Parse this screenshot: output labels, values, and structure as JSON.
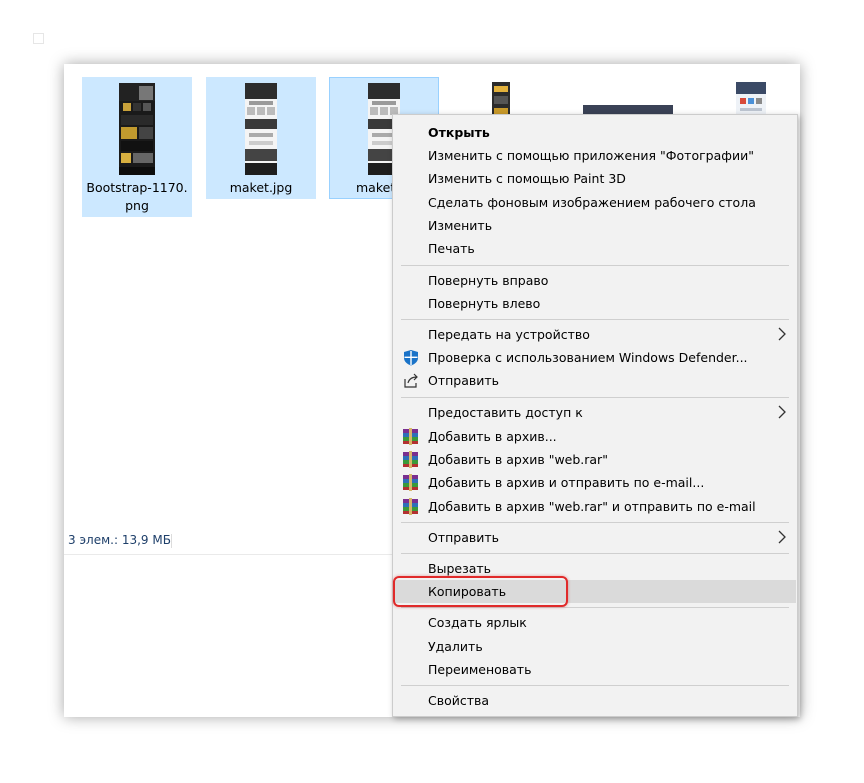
{
  "files": [
    {
      "name": "Bootstrap-1170.png"
    },
    {
      "name": "maket.jpg"
    },
    {
      "name": "maket."
    }
  ],
  "status": {
    "text": "3 элем.: 13,9 МБ"
  },
  "context_menu": {
    "items": [
      {
        "label": "Открыть"
      },
      {
        "label": "Изменить с помощью приложения \"Фотографии\""
      },
      {
        "label": "Изменить с помощью Paint 3D"
      },
      {
        "label": "Сделать фоновым изображением рабочего стола"
      },
      {
        "label": "Изменить"
      },
      {
        "label": "Печать"
      },
      {
        "label": "Повернуть вправо"
      },
      {
        "label": "Повернуть влево"
      },
      {
        "label": "Передать на устройство"
      },
      {
        "label": "Проверка с использованием Windows Defender..."
      },
      {
        "label": "Отправить"
      },
      {
        "label": "Предоставить доступ к"
      },
      {
        "label": "Добавить в архив..."
      },
      {
        "label": "Добавить в архив \"web.rar\""
      },
      {
        "label": "Добавить в архив и отправить по e-mail..."
      },
      {
        "label": "Добавить в архив \"web.rar\" и отправить по e-mail"
      },
      {
        "label": "Отправить"
      },
      {
        "label": "Вырезать"
      },
      {
        "label": "Копировать"
      },
      {
        "label": "Создать ярлык"
      },
      {
        "label": "Удалить"
      },
      {
        "label": "Переименовать"
      },
      {
        "label": "Свойства"
      }
    ]
  },
  "colors": {
    "selection": "#cce8ff",
    "menu_bg": "#f2f2f2",
    "hover": "#dadada",
    "highlight": "#e02a2a",
    "status_text": "#1e3f6a"
  },
  "icons": {
    "defender": "windows-defender-shield-icon",
    "share": "share-icon",
    "rar": "winrar-archive-icon",
    "submenu": "chevron-right-icon"
  }
}
